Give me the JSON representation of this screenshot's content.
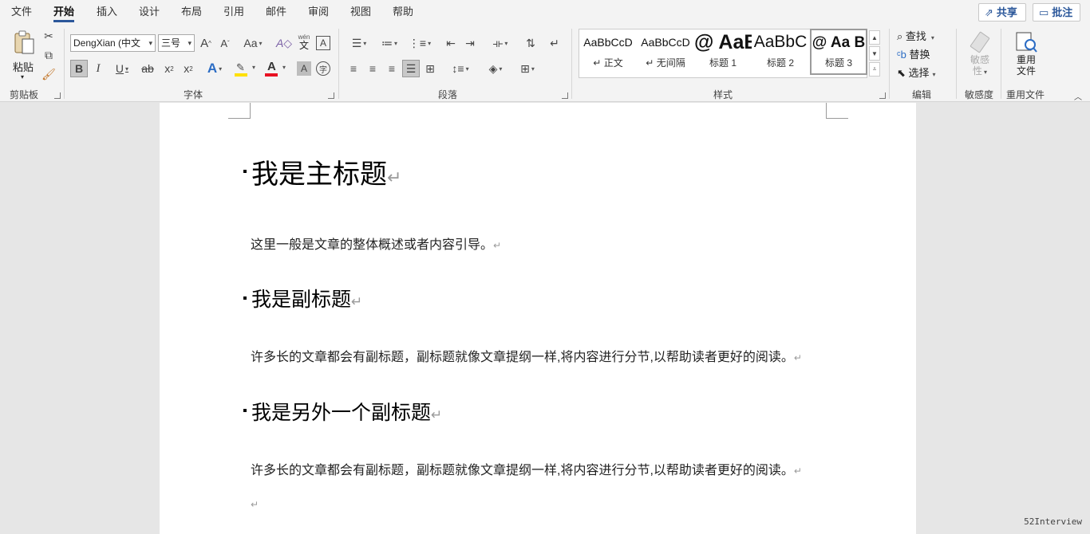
{
  "menu": {
    "tabs": [
      "文件",
      "开始",
      "插入",
      "设计",
      "布局",
      "引用",
      "邮件",
      "审阅",
      "视图",
      "帮助"
    ],
    "active": "开始",
    "share_label": "共享",
    "comment_label": "批注"
  },
  "ribbon": {
    "clipboard": {
      "paste_label": "粘贴",
      "group_label": "剪贴板"
    },
    "font": {
      "font_name": "DengXian (中文",
      "font_size": "三号",
      "grow_label": "A",
      "shrink_label": "A",
      "case_label": "Aa",
      "phonetic_top": "wén",
      "phonetic_bottom": "文",
      "border_char_label": "A",
      "bold": "B",
      "italic": "I",
      "underline": "U",
      "strike": "ab",
      "subscript": "x",
      "superscript": "x",
      "effects": "A",
      "font_color": "A",
      "shading": "A",
      "enclose": "字",
      "group_label": "字体",
      "highlight_color": "#ffe000",
      "font_color_value": "#e81123"
    },
    "paragraph": {
      "group_label": "段落"
    },
    "styles": {
      "items": [
        {
          "preview": "AaBbCcD",
          "name": "正文"
        },
        {
          "preview": "AaBbCcD",
          "name": "无间隔"
        },
        {
          "preview": "AaBl",
          "name": "标题 1"
        },
        {
          "preview": "AaBbC",
          "name": "标题 2"
        },
        {
          "preview": "Aa B",
          "name": "标题 3"
        }
      ],
      "group_label": "样式"
    },
    "editing": {
      "find": "查找",
      "replace": "替换",
      "select": "选择",
      "group_label": "编辑"
    },
    "sensitivity": {
      "button_line1": "敏感",
      "button_line2": "性",
      "group_label": "敏感度"
    },
    "reuse": {
      "button_line1": "重用",
      "button_line2": "文件",
      "group_label": "重用文件"
    }
  },
  "document": {
    "title": "我是主标题",
    "intro": "这里一般是文章的整体概述或者内容引导。",
    "subtitle1": "我是副标题",
    "para1": "许多长的文章都会有副标题，副标题就像文章提纲一样,将内容进行分节,以帮助读者更好的阅读。",
    "subtitle2": "我是另外一个副标题",
    "para2": "许多长的文章都会有副标题，副标题就像文章提纲一样,将内容进行分节,以帮助读者更好的阅读。",
    "paragraph_mark": "↵"
  },
  "watermark": "52Interview",
  "colors": {
    "accent": "#2b579a",
    "canvas": "#e6e6e6",
    "ribbon": "#f3f3f3"
  }
}
